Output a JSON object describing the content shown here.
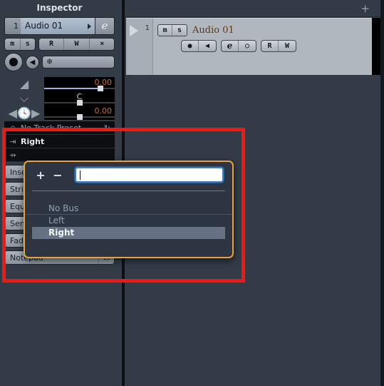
{
  "inspector": {
    "title": "Inspector",
    "track": {
      "number": "1",
      "name": "Audio 01",
      "edit_button": "e",
      "expand_icon": "caret-right-icon"
    },
    "toggles": {
      "mute": "m",
      "solo": "s",
      "read": "R",
      "write": "W",
      "crossfade": "crossfade-icon"
    },
    "record_icon": "record-enable-icon",
    "monitor_icon": "monitor-speaker-icon",
    "freeze_icon": "freeze-snowflake-icon",
    "meters": {
      "volume_icon": "volume-ramp-icon",
      "volume_value": "0.00",
      "pan_icon": "pan-icon",
      "pan_value": "C",
      "delay_icon": "delay-clock-icon",
      "delay_value": "0.00"
    },
    "routing": {
      "preset_icon": "diamond-preset-icon",
      "preset_label": "No Track Preset",
      "preset_reset_icon": "reset-arrow-icon",
      "input_icon": "input-arrow-icon",
      "input_label": "Right",
      "output_icon": "output-arrow-icon",
      "output_label": ""
    },
    "sections": [
      {
        "label": "Inserts",
        "mini_icon": "inserts-icon"
      },
      {
        "label": "Strip",
        "mini_icon": "strip-icon"
      },
      {
        "label": "Equalizers",
        "mini_icon": "eq-icon"
      },
      {
        "label": "Sends",
        "mini_icon": "sends-icon"
      },
      {
        "label": "Fader",
        "mini_icon": "fader-icon"
      },
      {
        "label": "Notepad",
        "mini_icon": "notepad-icon"
      }
    ]
  },
  "track_list": {
    "add_track_icon": "+",
    "row": {
      "play_icon": "play-triangle-icon",
      "number": "1",
      "mute": "m",
      "solo": "s",
      "name": "Audio 01",
      "controls": [
        {
          "label": "record-dot-icon",
          "glyph": "●"
        },
        {
          "label": "monitor-icon",
          "glyph": "◀"
        },
        {
          "label": "edit-channel-icon",
          "glyph": "e"
        },
        {
          "label": "automation-read-icon",
          "glyph": "○"
        },
        {
          "label": "read-button",
          "glyph": "R"
        },
        {
          "label": "write-button",
          "glyph": "W"
        }
      ]
    }
  },
  "popup": {
    "add_label": "+",
    "remove_label": "−",
    "search_value": "",
    "search_placeholder": "",
    "items": [
      {
        "label": "No Bus",
        "selected": false
      },
      {
        "label": "Left",
        "selected": false
      },
      {
        "label": "Right",
        "selected": true
      }
    ]
  },
  "annotation": {
    "color": "#f21616",
    "shape": "rectangle"
  }
}
